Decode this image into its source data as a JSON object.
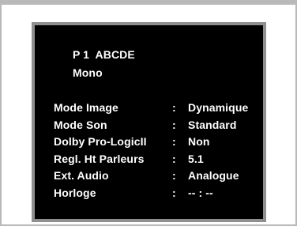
{
  "header": {
    "channel": "P 1  ABCDE",
    "sound_mode": "Mono"
  },
  "menu": {
    "separator": ":",
    "items": [
      {
        "label": "Mode Image",
        "value": "Dynamique"
      },
      {
        "label": "Mode Son",
        "value": "Standard"
      },
      {
        "label": "Dolby Pro-LogicII",
        "value": "Non"
      },
      {
        "label": "Regl. Ht Parleurs",
        "value": "5.1"
      },
      {
        "label": "Ext. Audio",
        "value": "Analogue"
      },
      {
        "label": "Horloge",
        "value": "-- : --"
      }
    ]
  },
  "colors": {
    "osd_background": "#000000",
    "osd_border": "#8f8f8f",
    "frame_border": "#b9b9b9",
    "text": "#ffffff"
  }
}
